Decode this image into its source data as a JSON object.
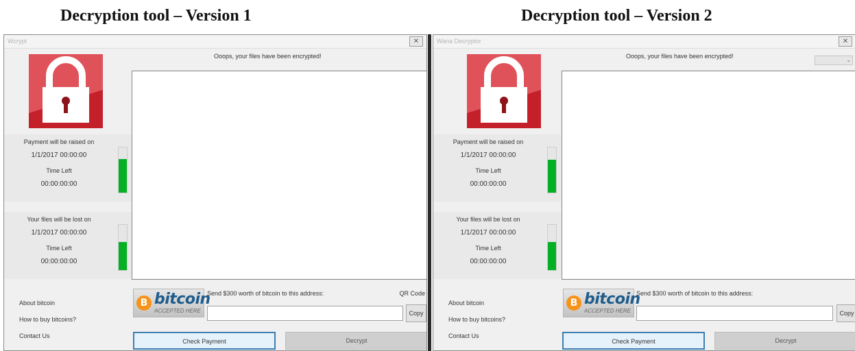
{
  "captions": {
    "v1": "Decryption tool – Version 1",
    "v2": "Decryption tool – Version 2"
  },
  "windows": [
    {
      "title": "Wcrypt",
      "close": "✕",
      "header": "Ooops, your files have been encrypted!",
      "payment": {
        "label": "Payment will be raised on",
        "date": "1/1/2017 00:00:00",
        "time_left_label": "Time Left",
        "time_left": "00:00:00:00",
        "progress": 0.75
      },
      "lost": {
        "label": "Your files will be lost on",
        "date": "1/1/2017 00:00:00",
        "time_left_label": "Time Left",
        "time_left": "00:00:00:00",
        "progress": 0.62
      },
      "links": [
        "About bitcoin",
        "How to buy bitcoins?",
        "Contact Us"
      ],
      "bitcoin": {
        "coin": "B",
        "word": "bitcoin",
        "sub": "ACCEPTED HERE"
      },
      "send_label": "Send $300 worth of bitcoin to this address:",
      "qr_label": "QR Code",
      "copy_label": "Copy",
      "check_label": "Check Payment",
      "decrypt_label": "Decrypt"
    },
    {
      "title": "Wana Decryptor",
      "close": "✕",
      "header": "Ooops, your files have been encrypted!",
      "language_dropdown": "⌄",
      "payment": {
        "label": "Payment will be raised on",
        "date": "1/1/2017 00:00:00",
        "time_left_label": "Time Left",
        "time_left": "00:00:00:00",
        "progress": 0.72
      },
      "lost": {
        "label": "Your files will be lost on",
        "date": "1/1/2017 00:00:00",
        "time_left_label": "Time Left",
        "time_left": "00:00:00:00",
        "progress": 0.62
      },
      "links": [
        "About bitcoin",
        "How to buy bitcoins?",
        "Contact Us"
      ],
      "bitcoin": {
        "coin": "B",
        "word": "bitcoin",
        "sub": "ACCEPTED HERE"
      },
      "send_label": "Send $300 worth of bitcoin to this address:",
      "copy_label": "Copy",
      "check_label": "Check Payment",
      "decrypt_label": "Decrypt"
    }
  ],
  "colors": {
    "lock_red": "#c4202a",
    "progress_green": "#06b025",
    "bitcoin_orange": "#f7931a",
    "bitcoin_blue": "#1e5c8c"
  },
  "icons": {
    "lock": "padlock-icon",
    "bitcoin": "bitcoin-logo"
  }
}
